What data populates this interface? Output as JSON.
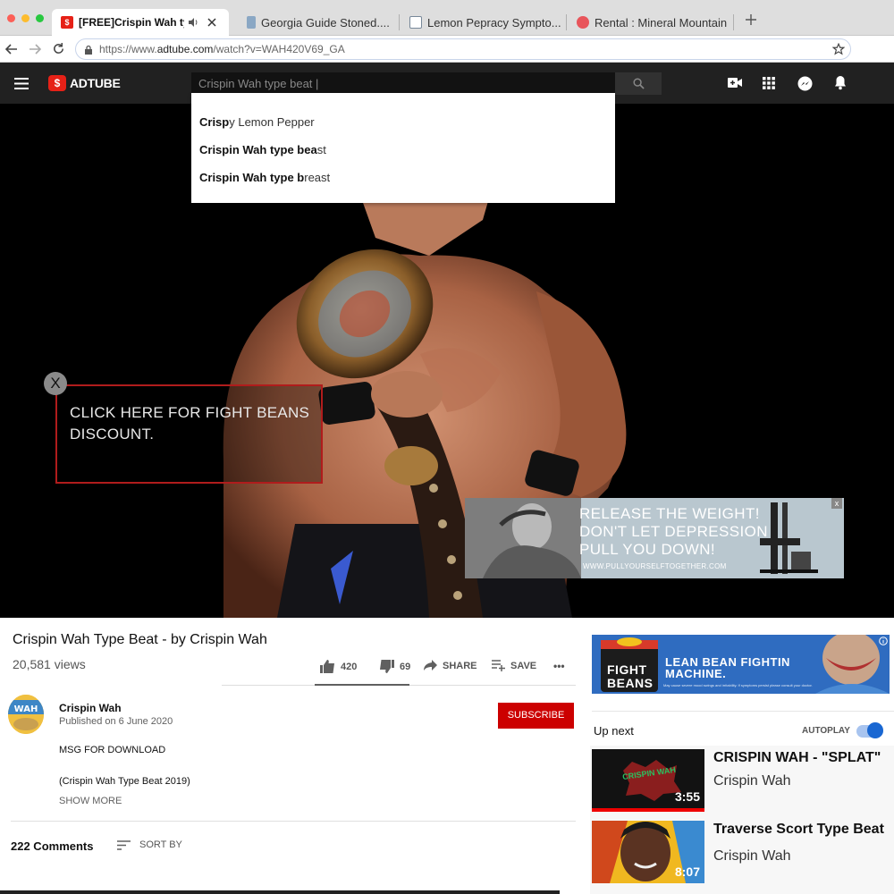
{
  "browser": {
    "tabs": [
      {
        "label": "[FREE]Crispin Wah typ",
        "active": true,
        "favicon": "adtube-icon"
      },
      {
        "label": "Georgia Guide Stoned....",
        "active": false,
        "favicon": "document-icon"
      },
      {
        "label": "Lemon Pepracy Sympto...",
        "active": false,
        "favicon": "hospital-icon"
      },
      {
        "label": "Rental : Mineral Mountain",
        "active": false,
        "favicon": "rental-icon"
      }
    ],
    "url_prefix": "https://www.",
    "url_domain": "adtube.com",
    "url_path": "/watch?v=WAH420V69_GA"
  },
  "site": {
    "logo_text": "ADTUBE",
    "search_value": "Crispin Wah type beat |",
    "suggestions": [
      {
        "bold": "Crisp",
        "rest": "y Lemon Pepper"
      },
      {
        "bold": "Crispin Wah type bea",
        "rest": "st"
      },
      {
        "bold": "Crispin Wah type b",
        "rest": "reast"
      }
    ]
  },
  "ads": {
    "overlay_close": "X",
    "overlay_text": "CLICK HERE FOR FIGHT BEANS DISCOUNT.",
    "banner_line1": "RELEASE THE WEIGHT!",
    "banner_line2": "DON'T LET DEPRESSION",
    "banner_line3": "PULL YOU DOWN!",
    "banner_url": "WWW.PULLYOURSELFTOGETHER.COM",
    "banner_close": "x",
    "side_brand1": "FIGHT",
    "side_brand2": "BEANS",
    "side_headline1": "LEAN BEAN FIGHTIN",
    "side_headline2": "MACHINE.",
    "side_fine_print": "May cause severe mood swings and irritability. If symptoms persist please consult your doctor."
  },
  "video": {
    "title": "Crispin Wah Type Beat - by Crispin Wah",
    "views": "20,581 views",
    "likes": "420",
    "dislikes": "69",
    "share_label": "SHARE",
    "save_label": "SAVE",
    "more_label": "•••"
  },
  "channel": {
    "name": "Crispin Wah",
    "avatar_text": "WAH",
    "published": "Published on 6 June 2020",
    "subscribe_label": "SUBSCRIBE",
    "desc_line1": "MSG FOR DOWNLOAD",
    "desc_line2": "(Crispin Wah Type Beat 2019)",
    "show_more": "SHOW MORE"
  },
  "comments": {
    "count_label": "222 Comments",
    "sort_label": "SORT BY"
  },
  "sidebar": {
    "up_next": "Up next",
    "autoplay": "AUTOPLAY",
    "autoplay_on": true,
    "related": [
      {
        "title": "CRISPIN WAH - \"SPLAT\"",
        "channel": "Crispin Wah",
        "duration": "3:55",
        "thumb_text": "CRISPIN WAH"
      },
      {
        "title": "Traverse Scort Type Beat",
        "channel": "Crispin Wah",
        "duration": "8:07"
      }
    ]
  },
  "colors": {
    "brand_red": "#cc0000",
    "header_dark": "#212121",
    "overlay_border": "#b01c1c",
    "toggle_blue": "#1967d2"
  }
}
